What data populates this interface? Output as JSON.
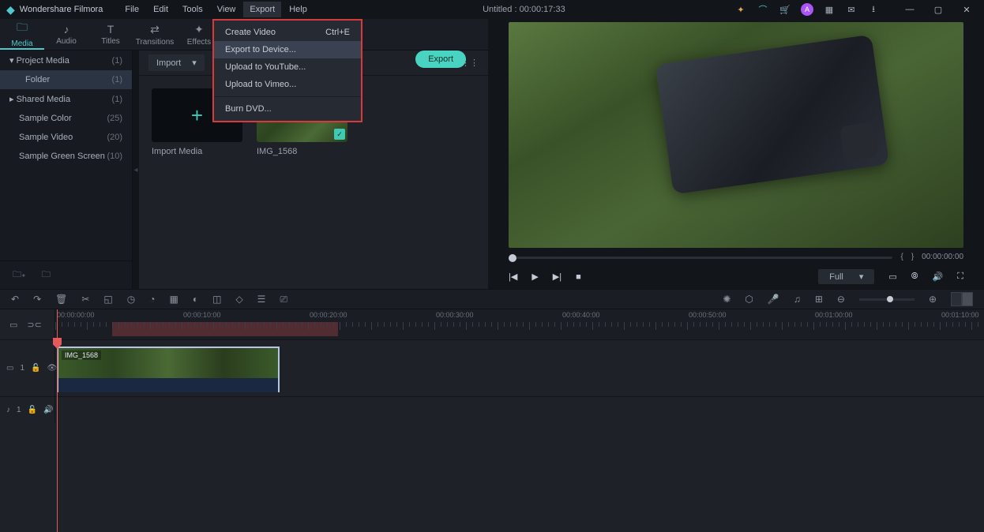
{
  "titlebar": {
    "brand": "Wondershare Filmora",
    "menus": [
      "File",
      "Edit",
      "Tools",
      "View",
      "Export",
      "Help"
    ],
    "active_menu_index": 4,
    "center": "Untitled : 00:00:17:33",
    "avatar_letter": "A"
  },
  "tabs": [
    {
      "label": "Media",
      "icon": "folder"
    },
    {
      "label": "Audio",
      "icon": "music"
    },
    {
      "label": "Titles",
      "icon": "text"
    },
    {
      "label": "Transitions",
      "icon": "transition"
    },
    {
      "label": "Effects",
      "icon": "effects"
    }
  ],
  "active_tab": 0,
  "export_button": "Export",
  "sidebar": {
    "items": [
      {
        "label": "Project Media",
        "count": "(1)",
        "arrow": "▾",
        "header": true
      },
      {
        "label": "Folder",
        "count": "(1)",
        "selected": true,
        "indent": true
      },
      {
        "label": "Shared Media",
        "count": "(1)",
        "arrow": "▸",
        "header": true
      },
      {
        "label": "Sample Color",
        "count": "(25)",
        "indent": true
      },
      {
        "label": "Sample Video",
        "count": "(20)",
        "indent": true
      },
      {
        "label": "Sample Green Screen",
        "count": "(10)",
        "indent": true
      }
    ]
  },
  "media_toolbar": {
    "import_label": "Import"
  },
  "thumbs": [
    {
      "label": "Import Media",
      "type": "import"
    },
    {
      "label": "IMG_1568",
      "type": "clip",
      "checked": true
    }
  ],
  "export_menu": {
    "items": [
      {
        "label": "Create Video",
        "shortcut": "Ctrl+E"
      },
      {
        "label": "Export to Device...",
        "highlight": true
      },
      {
        "label": "Upload to YouTube..."
      },
      {
        "label": "Upload to Vimeo..."
      }
    ],
    "bottom": {
      "label": "Burn DVD..."
    }
  },
  "preview": {
    "scrub_left": "{",
    "scrub_right": "}",
    "time": "00:00:00:00",
    "fit_label": "Full"
  },
  "ruler": {
    "ticks": [
      "00:00:00:00",
      "00:00:10:00",
      "00:00:20:00",
      "00:00:30:00",
      "00:00:40:00",
      "00:00:50:00",
      "00:01:00:00",
      "00:01:10:00"
    ]
  },
  "tracks": {
    "video_label": "1",
    "audio_label": "1",
    "clip_name": "IMG_1568"
  }
}
